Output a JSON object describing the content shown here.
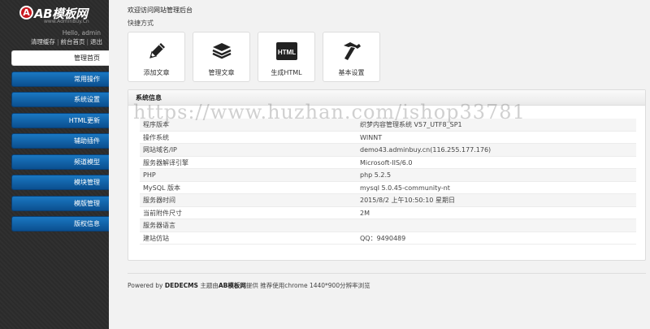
{
  "brand": {
    "badge": "A",
    "name": "AB模板网",
    "url": "www.AdminBuy.Cn"
  },
  "user": {
    "greeting": "Hello, admin"
  },
  "quicklinks": [
    "清理缓存",
    "前台首页",
    "退出"
  ],
  "nav": [
    "管理首页",
    "常用操作",
    "系统设置",
    "HTML更新",
    "辅助插件",
    "频道模型",
    "模块管理",
    "模版管理",
    "版权信息"
  ],
  "main": {
    "welcome": "欢迎访问网站管理后台",
    "shortcut_title": "快捷方式",
    "shortcuts": [
      {
        "label": "添加文章",
        "icon": "pencil-icon"
      },
      {
        "label": "管理文章",
        "icon": "stack-icon"
      },
      {
        "label": "生成HTML",
        "icon": "html-icon",
        "icon_text": "HTML"
      },
      {
        "label": "基本设置",
        "icon": "hammer-icon"
      }
    ],
    "panel_title": "系统信息",
    "info": [
      {
        "k": "程序版本",
        "v": "织梦内容管理系统 V57_UTF8_SP1"
      },
      {
        "k": "操作系统",
        "v": "WINNT"
      },
      {
        "k": "网站域名/IP",
        "v": "demo43.adminbuy.cn(116.255.177.176)"
      },
      {
        "k": "服务器解译引擎",
        "v": "Microsoft-IIS/6.0"
      },
      {
        "k": "PHP",
        "v": "php 5.2.5"
      },
      {
        "k": "MySQL 版本",
        "v": "mysql 5.0.45-community-nt"
      },
      {
        "k": "服务器时间",
        "v": "2015/8/2 上午10:50:10 星期日"
      },
      {
        "k": "当前附件尺寸",
        "v": "2M"
      },
      {
        "k": "服务器语言",
        "v": ""
      },
      {
        "k": "建站仿站",
        "v": "QQ：9490489"
      }
    ]
  },
  "watermark": "https://www.huzhan.com/ishop33781",
  "footer": {
    "prefix": "Powered by",
    "cms": "DEDECMS",
    "mid": "主题由",
    "brand": "AB模板网",
    "suffix": "提供 推荐使用chrome 1440*900分辨率浏览"
  },
  "colors": {
    "nav_blue": "#0b5fa8",
    "sidebar_bg": "#2b2b2b",
    "brand_red": "#c8161d"
  }
}
